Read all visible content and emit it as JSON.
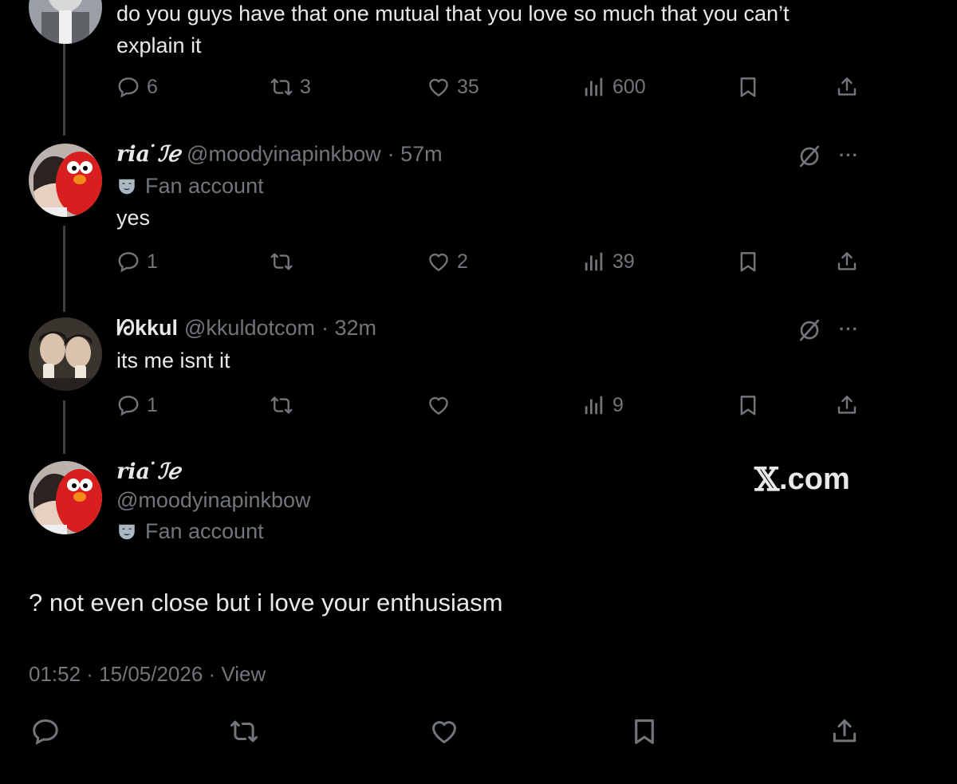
{
  "thread": {
    "parent": {
      "text_line1": "do you guys have that one mutual that you love so much that you can’t",
      "text_line2": "explain it",
      "replies": "6",
      "reposts": "3",
      "likes": "35",
      "views": "600"
    },
    "reply1": {
      "display_name": "ria ̇ℐℯ",
      "handle": "@moodyinapinkbow",
      "time": "· 57m",
      "badge_label": "Fan account",
      "text": "yes",
      "replies": "1",
      "reposts": "",
      "likes": "2",
      "views": "39",
      "more": "···"
    },
    "reply2": {
      "display_name": "ᘗkkul",
      "handle": "@kkuldotcom",
      "time": "· 32m",
      "text": "its me isnt it",
      "replies": "1",
      "reposts": "",
      "likes": "",
      "views": "9",
      "more": "···"
    }
  },
  "focused": {
    "display_name": "ria ̇ℐℯ",
    "handle": "@moodyinapinkbow",
    "badge_label": "Fan account",
    "text": "? not even close but i love your enthusiasm",
    "timestamp": "01:52 · 15/05/2026 · View"
  },
  "brand": {
    "x": "𝕏",
    "domain": ".com"
  },
  "colors": {
    "background": "#000000",
    "text": "#e7e9ea",
    "muted": "#71767b",
    "thread_line": "#3d4145"
  }
}
